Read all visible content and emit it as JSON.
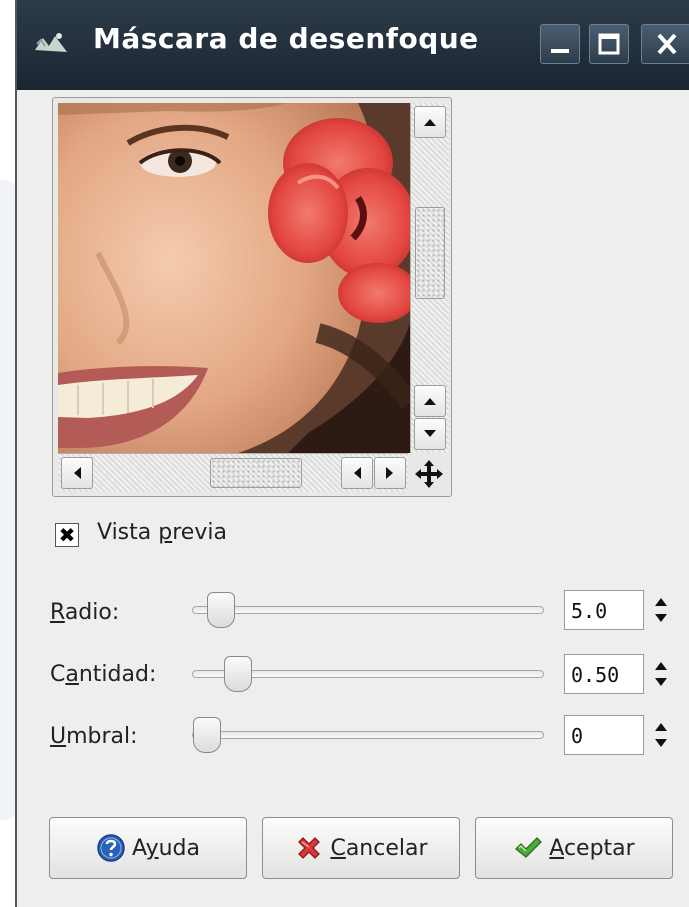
{
  "window": {
    "title": "Máscara de desenfoque",
    "controls": {
      "minimize": "_",
      "maximize": "☐",
      "close": "✕"
    }
  },
  "preview": {
    "checkbox_label_pre": "Vista ",
    "checkbox_label_mnemonic": "p",
    "checkbox_label_post": "revia",
    "checked": true,
    "check_mark": "✖"
  },
  "params": [
    {
      "mnemonic": "R",
      "label_rest": "adio:",
      "label_pre": "",
      "value": "5.0"
    },
    {
      "mnemonic": "a",
      "label_pre": "C",
      "label_rest": "ntidad:",
      "value": "0.50"
    },
    {
      "mnemonic": "U",
      "label_pre": "",
      "label_rest": "mbral:",
      "value": "0"
    }
  ],
  "buttons": {
    "help": {
      "pre": "A",
      "mnemonic": "y",
      "post": "uda"
    },
    "cancel": {
      "pre": "",
      "mnemonic": "C",
      "post": "ancelar"
    },
    "ok": {
      "pre": "",
      "mnemonic": "A",
      "post": "ceptar"
    }
  },
  "icons": {
    "help": "help-icon",
    "cancel": "cancel-icon",
    "ok": "ok-icon",
    "navigate": "navigate-icon"
  },
  "colors": {
    "titlebar": "#1f2b38",
    "dialog_bg": "#eeeeec",
    "help_blue": "#2a62b8",
    "cancel_red": "#d9383a",
    "ok_green": "#4caa3a"
  }
}
